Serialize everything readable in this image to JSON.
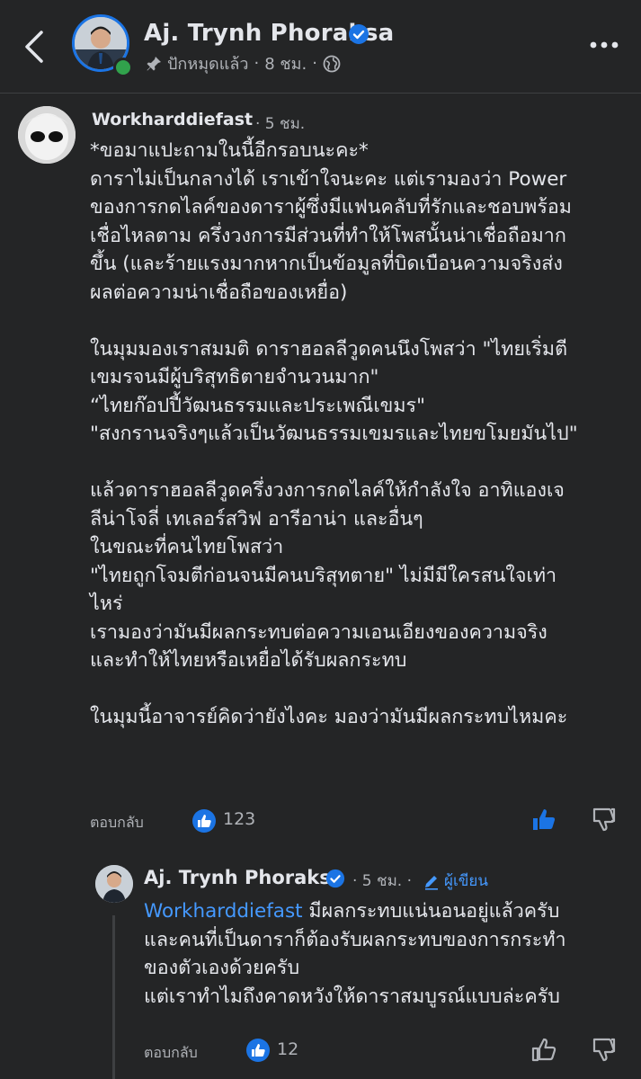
{
  "header": {
    "page_name": "Aj. Trynh Phoraksa",
    "pinned_label": "ปักหมุดแล้ว",
    "separator": "·",
    "time": "8 ชม.",
    "colors": {
      "background": "#242526",
      "accent": "#1b74e4",
      "online": "#31a24c"
    }
  },
  "comment": {
    "author": "Workharddiefast",
    "time": "· 5 ชม.",
    "body": "*ขอมาแปะถามในนี้อีกรอบนะคะ*\nดาราไม่เป็นกลางได้ เราเข้าใจนะคะ แต่เรามองว่า Power\nของการกดไลค์ของดาราผู้ซึ่งมีแฟนคลับที่รักและชอบพร้อม\nเชื่อไหลตาม ครึ่งวงการมีส่วนที่ทำให้โพสนั้นน่าเชื่อถือมาก\nขึ้น (และร้ายแรงมากหากเป็นข้อมูลที่บิดเบือนความจริงส่ง\nผลต่อความน่าเชื่อถือของเหยื่อ)\n\nในมุมมองเราสมมติ ดาราฮอลลีวูดคนนึงโพสว่า \"ไทยเริ่มตี\nเขมรจนมีผู้บริสุทธิตายจำนวนมาก\"\n“ไทยก๊อปปี้วัฒนธรรมและประเพณีเขมร\"\n\"สงกรานจริงๆแล้วเป็นวัฒนธรรมเขมรและไทยขโมยมันไป\"\n\nแล้วดาราฮอลลีวูดครึ่งวงการกดไลค์ให้กำลังใจ อาทิแองเจ\nลีน่าโจลี่ เทเลอร์สวิฟ อารีอาน่า และอื่นๆ\nในขณะที่คนไทยโพสว่า\n\"ไทยถูกโจมตีก่อนจนมีคนบริสุทตาย\" ไม่มีมีใครสนใจเท่า\nไหร่\nเรามองว่ามันมีผลกระทบต่อความเอนเอียงของความจริง\nและทำให้ไทยหรือเหยื่อได้รับผลกระทบ\n\nในมุมนี้อาจารย์คิดว่ายังไงคะ มองว่ามันมีผลกระทบไหมคะ",
    "reply_label": "ตอบกลับ",
    "like_count": "123"
  },
  "reply": {
    "author": "Aj. Trynh Phoraksa",
    "time": "· 5 ชม. ·",
    "author_badge": "ผู้เขียน",
    "mention": "Workharddiefast",
    "body": " มีผลกระทบแน่นอนอยู่แล้วครับ\nและคนที่เป็นดาราก็ต้องรับผลกระทบของการกระทำ\nของตัวเองด้วยครับ\nแต่เราทำไมถึงคาดหวังให้ดาราสมบูรณ์แบบล่ะครับ",
    "reply_label": "ตอบกลับ",
    "like_count": "12"
  }
}
